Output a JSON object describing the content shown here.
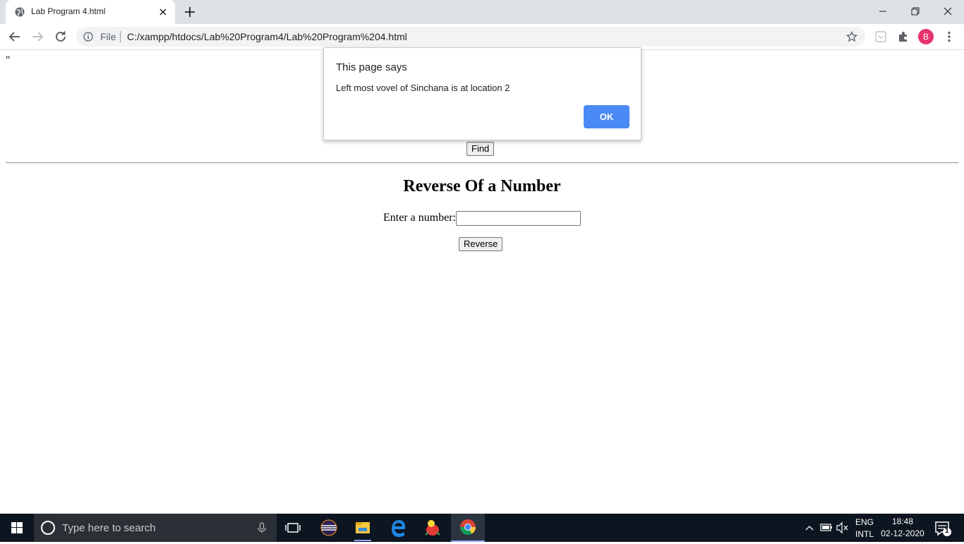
{
  "browser": {
    "tab_title": "Lab Program 4.html",
    "omnibox": {
      "scheme_label": "File",
      "url": "C:/xampp/htdocs/Lab%20Program4/Lab%20Program%204.html"
    },
    "profile_initial": "B"
  },
  "page": {
    "leftover_text": "\"",
    "find_button": "Find",
    "heading": "Reverse Of a Number",
    "number_label": "Enter a number:",
    "number_value": "",
    "reverse_button": "Reverse"
  },
  "dialog": {
    "title": "This page says",
    "message": "Left most vovel of Sinchana is at location 2",
    "ok_label": "OK"
  },
  "taskbar": {
    "search_placeholder": "Type here to search",
    "lang_top": "ENG",
    "lang_bottom": "INTL",
    "time": "18:48",
    "date": "02-12-2020",
    "notifications": "1"
  },
  "colors": {
    "dialog_ok": "#4a8af4",
    "avatar": "#e8336d",
    "taskbar": "#0d1520"
  }
}
